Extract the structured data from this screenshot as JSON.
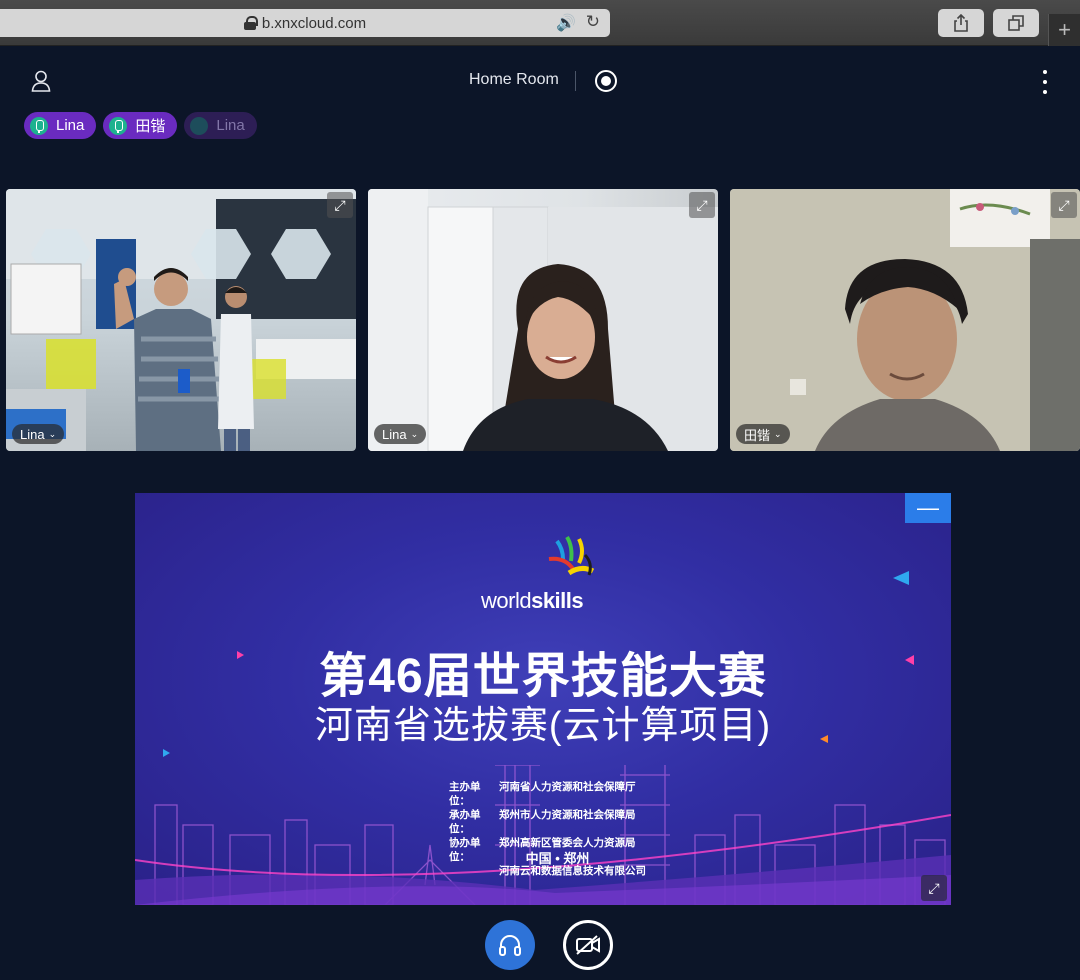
{
  "browser": {
    "url": "b.xnxcloud.com"
  },
  "header": {
    "room_title": "Home Room"
  },
  "participants": [
    {
      "name": "Lina",
      "active": true
    },
    {
      "name": "田锴",
      "active": true
    },
    {
      "name": "Lina",
      "active": false
    }
  ],
  "videos": [
    {
      "name": "Lina"
    },
    {
      "name": "Lina"
    },
    {
      "name": "田锴"
    }
  ],
  "slide": {
    "logo_world": "world",
    "logo_skills": "skills",
    "title": "第46届世界技能大赛",
    "subtitle": "河南省选拔赛(云计算项目)",
    "organizers": [
      {
        "label": "主办单位：",
        "value": "河南省人力资源和社会保障厅"
      },
      {
        "label": "承办单位：",
        "value": "郑州市人力资源和社会保障局"
      },
      {
        "label": "协办单位：",
        "value": "郑州高新区管委会人力资源局"
      },
      {
        "label": "",
        "value": "河南云和数据信息技术有限公司"
      }
    ],
    "location": "中国 • 郑州"
  },
  "colors": {
    "background": "#0c1528",
    "chip_active": "#6a2bc0",
    "mic_green": "#1db28f",
    "audio_button": "#2e73d8",
    "slide_blue": "#312ea3"
  }
}
